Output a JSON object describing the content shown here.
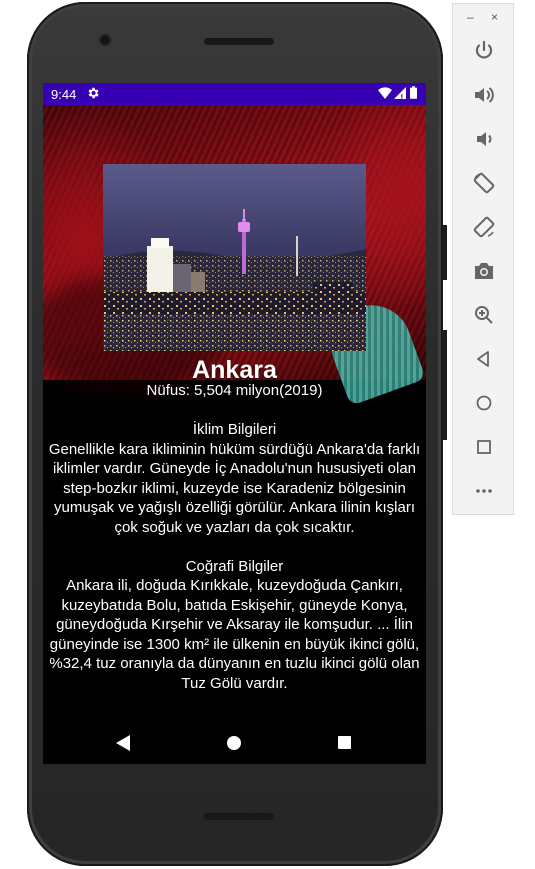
{
  "status_bar": {
    "time": "9:44",
    "icons": [
      "settings-icon",
      "wifi-icon",
      "signal-icon",
      "battery-icon"
    ],
    "color": "#3700b3"
  },
  "city": {
    "name": "Ankara",
    "population": "Nüfus: 5,504 milyon(2019)"
  },
  "climate": {
    "heading": "İklim Bilgileri",
    "text": "Genellikle kara ikliminin hüküm sürdüğü Ankara'da farklı iklimler vardır. Güneyde İç Anadolu'nun hususiyeti olan step-bozkır iklimi, kuzeyde ise Karadeniz bölgesinin yumuşak ve yağışlı özelliği görülür. Ankara ilinin kışları çok soğuk ve yazları da çok sıcaktır."
  },
  "geography": {
    "heading": "Coğrafi Bilgiler",
    "text": "Ankara ili, doğuda Kırıkkale, kuzeydoğuda Çankırı, kuzeybatıda Bolu, batıda Eskişehir, güneyde Konya, güneydoğuda Kırşehir ve Aksaray ile komşudur. ... İlin güneyinde ise 1300 km² ile ülkenin en büyük ikinci gölü, %32,4 tuz oranıyla da dünyanın en tuzlu ikinci gölü olan Tuz Gölü vardır."
  },
  "nav_bar": {
    "buttons": [
      "back-icon",
      "home-icon",
      "recents-icon"
    ]
  },
  "emulator_panel": {
    "window_controls": {
      "minimize": "–",
      "close": "×"
    },
    "buttons": [
      "power-icon",
      "volume-up-icon",
      "volume-down-icon",
      "rotate-left-icon",
      "rotate-right-icon",
      "camera-icon",
      "zoom-icon",
      "back-icon",
      "home-icon",
      "overview-icon",
      "more-icon"
    ]
  }
}
